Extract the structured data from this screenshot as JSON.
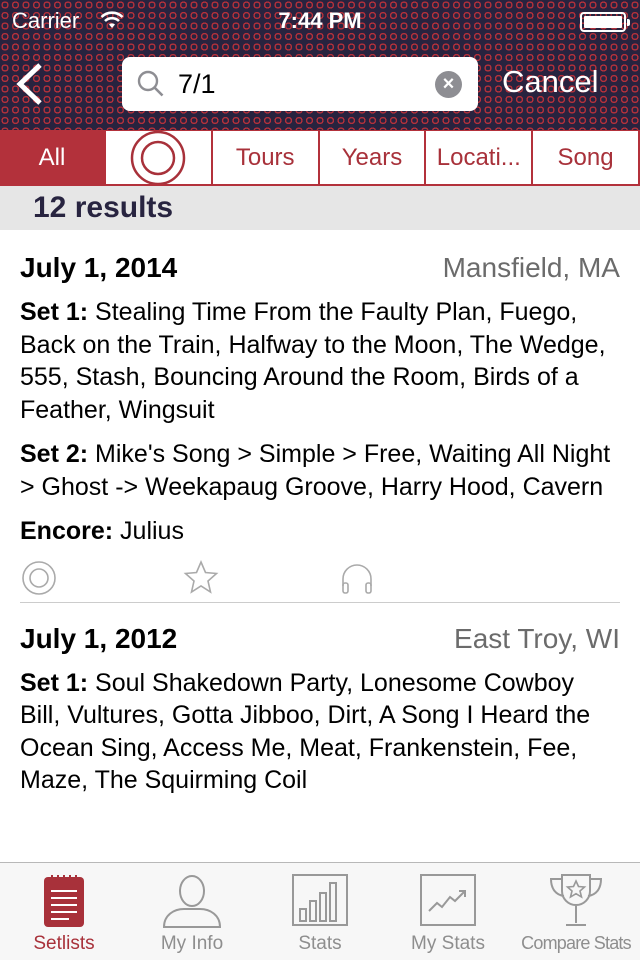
{
  "status_bar": {
    "carrier": "Carrier",
    "time": "7:44 PM"
  },
  "nav": {
    "search_value": "7/1",
    "cancel_label": "Cancel"
  },
  "filters": [
    {
      "label": "All",
      "active": true
    },
    {
      "label": "",
      "icon": "phish-logo-icon"
    },
    {
      "label": "Tours"
    },
    {
      "label": "Years"
    },
    {
      "label": "Locati..."
    },
    {
      "label": "Song"
    }
  ],
  "results_label": "12 results",
  "shows": [
    {
      "date": "July 1, 2014",
      "location": "Mansfield, MA",
      "sets": [
        {
          "label": "Set 1:",
          "songs": "Stealing Time From the Faulty Plan, Fuego, Back on the Train, Halfway to the Moon, The Wedge, 555, Stash, Bouncing Around the Room, Birds of a Feather, Wingsuit"
        },
        {
          "label": "Set 2:",
          "songs": "Mike's Song > Simple > Free, Waiting All Night > Ghost -> Weekapaug Groove, Harry Hood, Cavern"
        },
        {
          "label": "Encore:",
          "songs": "Julius"
        }
      ]
    },
    {
      "date": "July 1, 2012",
      "location": "East Troy, WI",
      "sets": [
        {
          "label": "Set 1:",
          "songs": "Soul Shakedown Party, Lonesome Cowboy Bill, Vultures, Gotta Jibboo, Dirt, A Song I Heard the Ocean Sing, Access Me, Meat, Frankenstein, Fee, Maze, The Squirming Coil"
        }
      ]
    }
  ],
  "tabs": [
    {
      "label": "Setlists",
      "icon": "notepad-icon",
      "active": true
    },
    {
      "label": "My Info",
      "icon": "person-icon"
    },
    {
      "label": "Stats",
      "icon": "bar-chart-icon"
    },
    {
      "label": "My Stats",
      "icon": "line-chart-icon"
    },
    {
      "label": "Compare Stats",
      "icon": "trophy-icon"
    }
  ],
  "colors": {
    "accent": "#b3313b",
    "header_bg": "#28233f"
  }
}
